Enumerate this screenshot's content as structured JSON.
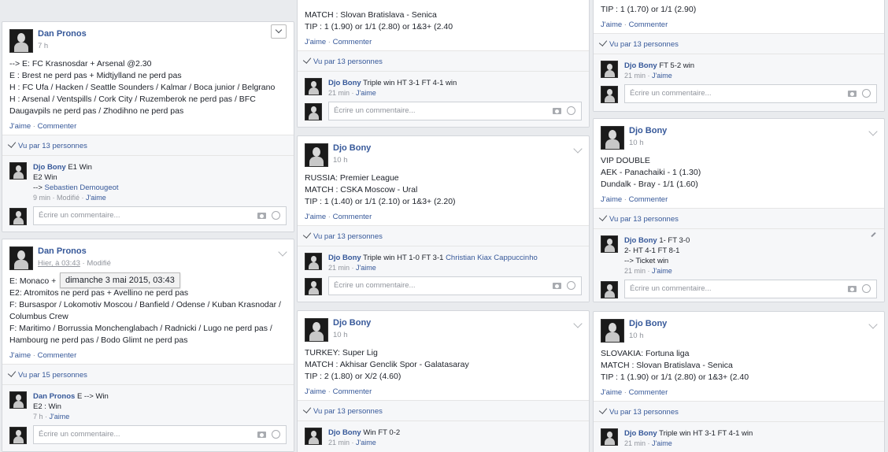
{
  "labels": {
    "like": "J'aime",
    "comment": "Commenter",
    "write_comment": "Écrire un commentaire...",
    "reply_like": "J'aime",
    "modified": "Modifié"
  },
  "tooltip": "dimanche 3 mai 2015, 03:43",
  "col1": {
    "post1": {
      "author": "Dan Pronos",
      "time": "7 h",
      "lines": [
        "--> E: FC Krasnosdar + Arsenal @2.30",
        "E : Brest ne perd pas + Midtjylland ne perd pas",
        "H : FC Ufa / Hacken / Seattle Sounders / Kalmar / Boca junior / Belgrano",
        "H : Arsenal / Ventspills / Cork City / Ruzemberok ne perd pas / BFC",
        "Daugavpils ne perd pas / Zhodihno ne perd pas"
      ],
      "seen": "Vu par 13 personnes",
      "comment": {
        "author": "Djo Bony",
        "text1": "E1 Win",
        "text2": "E2 Win",
        "text3_prefix": "--> ",
        "text3_link": "Sebastien Demougeot",
        "meta": "9 min · Modifié · "
      }
    },
    "post2": {
      "author": "Dan Pronos",
      "time_link": "Hier, à 03:43",
      "time_rest": " · Modifié",
      "lines": [
        "E: Monaco +",
        "E2: Atromitos ne perd pas + Avellino ne perd pas",
        "F: Bursaspor / Lokomotiv Moscou / Banfield / Odense / Kuban Krasnodar /",
        "Columbus Crew",
        "F: Maritimo / Borrussia Monchenglabach / Radnicki / Lugo ne perd pas /",
        "Hambourg ne perd pas / Bodo Glimt ne perd pas"
      ],
      "seen": "Vu par 15 personnes",
      "comment": {
        "author": "Dan Pronos",
        "text1": "E --> Win",
        "text2": "E2 : Win",
        "meta": "7 h · "
      }
    }
  },
  "col2": {
    "post0": {
      "lines": [
        "MATCH : Slovan Bratislava - Senica",
        "TIP : 1 (1.90) or 1/1 (2.80) or 1&3+ (2.40"
      ],
      "seen": "Vu par 13 personnes",
      "comment": {
        "author": "Djo Bony",
        "text": "Triple win HT 3-1 FT 4-1 win",
        "meta": "21 min · "
      }
    },
    "post1": {
      "author": "Djo Bony",
      "time": "10 h",
      "lines": [
        "RUSSIA: Premier League",
        "MATCH : CSKA Moscow - Ural",
        "TIP : 1 (1.40) or 1/1 (2.10) or 1&3+ (2.20)"
      ],
      "seen": "Vu par 13 personnes",
      "comment": {
        "author": "Djo Bony",
        "text": "Triple win HT 1-0 FT 3-1 ",
        "link": "Christian Kiax Cappuccinho",
        "meta": "21 min · "
      }
    },
    "post2": {
      "author": "Djo Bony",
      "time": "10 h",
      "lines": [
        "TURKEY: Super Lig",
        "MATCH : Akhisar Genclik Spor - Galatasaray",
        "TIP : 2 (1.80) or X/2 (4.60)"
      ],
      "seen": "Vu par 13 personnes",
      "comment": {
        "author": "Djo Bony",
        "text": "Win FT 0-2",
        "meta": "21 min · "
      }
    }
  },
  "col3": {
    "post0": {
      "lines": [
        "TIP : 1 (1.70) or 1/1 (2.90)"
      ],
      "seen": "Vu par 13 personnes",
      "comment": {
        "author": "Djo Bony",
        "text": "FT 5-2 win",
        "meta": "21 min · "
      }
    },
    "post1": {
      "author": "Djo Bony",
      "time": "10 h",
      "lines": [
        "VIP DOUBLE",
        "AEK - Panachaiki - 1 (1.30)",
        "Dundalk - Bray - 1/1 (1.60)"
      ],
      "seen": "Vu par 13 personnes",
      "comment": {
        "author": "Djo Bony",
        "text1": "1- FT 3-0",
        "text2": "2- HT 4-1 FT 8-1",
        "text3": "--> Ticket win",
        "meta": "21 min · "
      }
    },
    "post2": {
      "author": "Djo Bony",
      "time": "10 h",
      "lines": [
        "SLOVAKIA: Fortuna liga",
        "MATCH : Slovan Bratislava - Senica",
        "TIP : 1 (1.90) or 1/1 (2.80) or 1&3+ (2.40"
      ],
      "seen": "Vu par 13 personnes",
      "comment": {
        "author": "Djo Bony",
        "text": "Triple win HT 3-1 FT 4-1 win",
        "meta": "21 min · "
      }
    }
  }
}
